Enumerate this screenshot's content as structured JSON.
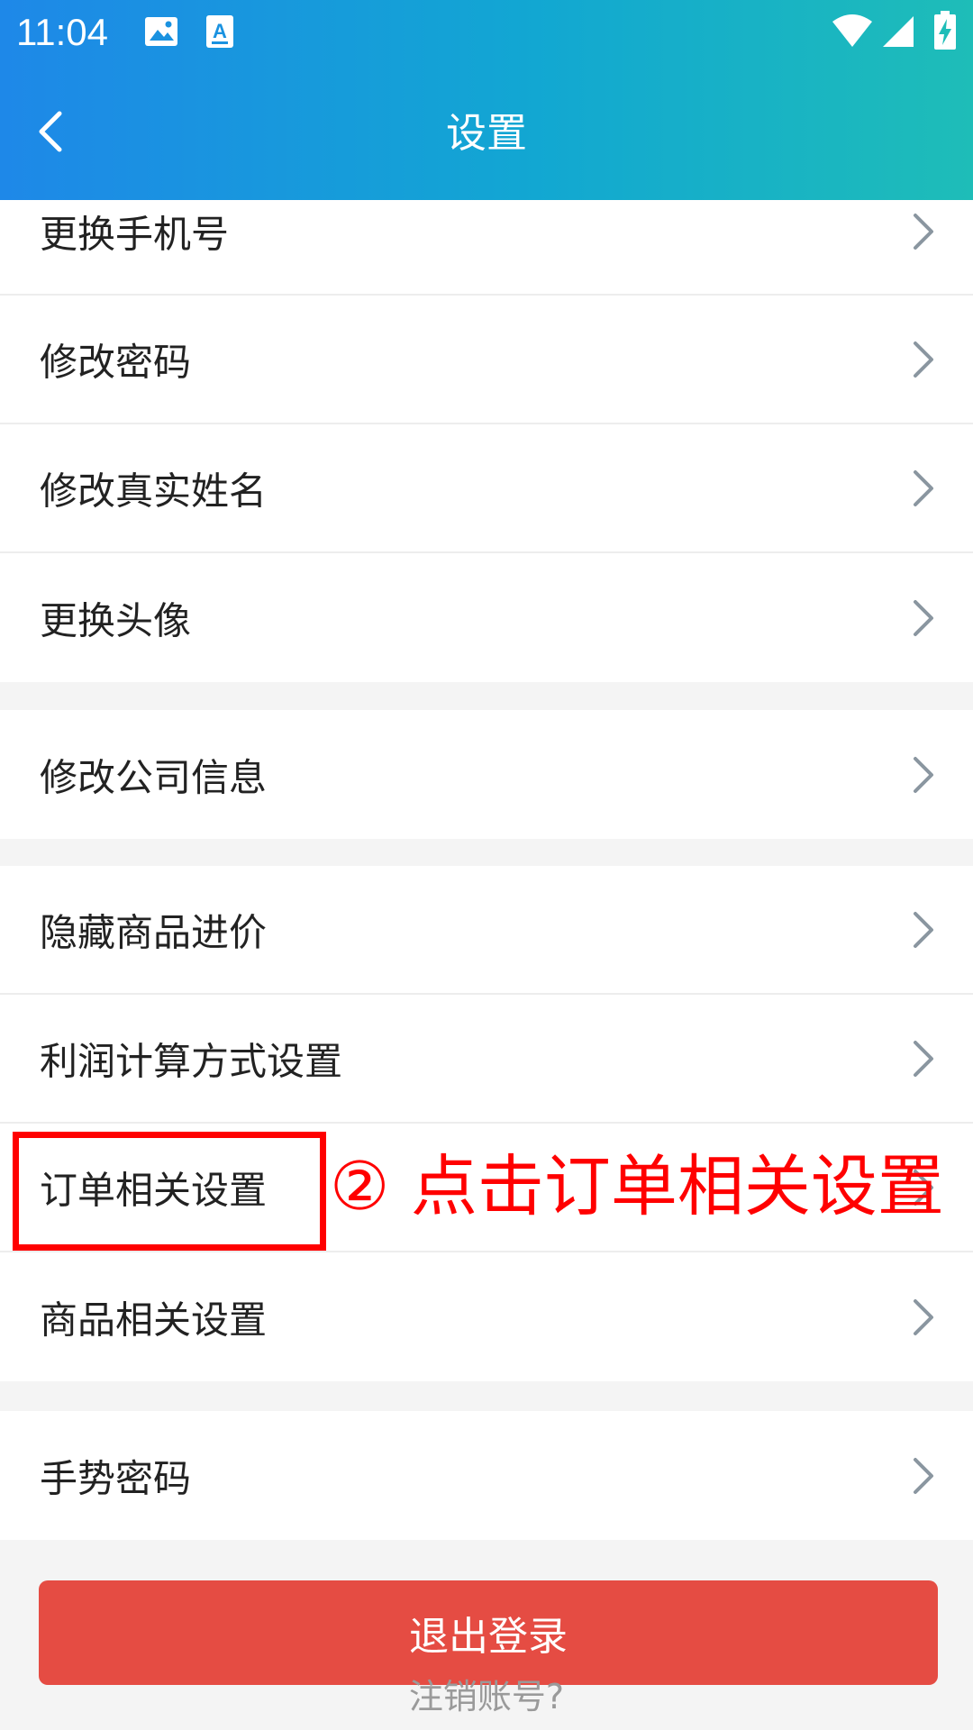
{
  "status_bar": {
    "time": "11:04",
    "icons": [
      "image-notification-icon",
      "a-notification-icon",
      "wifi-icon",
      "signal-icon",
      "battery-charging-icon"
    ]
  },
  "header": {
    "title": "设置",
    "back_icon": "chevron-left-icon"
  },
  "groups": [
    {
      "items": [
        {
          "label": "更换手机号"
        },
        {
          "label": "修改密码"
        },
        {
          "label": "修改真实姓名"
        },
        {
          "label": "更换头像"
        }
      ]
    },
    {
      "items": [
        {
          "label": "修改公司信息"
        }
      ]
    },
    {
      "items": [
        {
          "label": "隐藏商品进价"
        },
        {
          "label": "利润计算方式设置"
        },
        {
          "label": "订单相关设置"
        },
        {
          "label": "商品相关设置"
        }
      ]
    },
    {
      "items": [
        {
          "label": "手势密码"
        }
      ]
    }
  ],
  "annotation": {
    "text": "② 点击订单相关设置",
    "color": "#ff0000"
  },
  "actions": {
    "logout_label": "退出登录",
    "cancel_account_label": "注销账号?"
  },
  "colors": {
    "header_gradient_start": "#1e88e8",
    "header_gradient_end": "#1ebdb8",
    "logout_button": "#e54c43",
    "background": "#f4f4f4"
  }
}
